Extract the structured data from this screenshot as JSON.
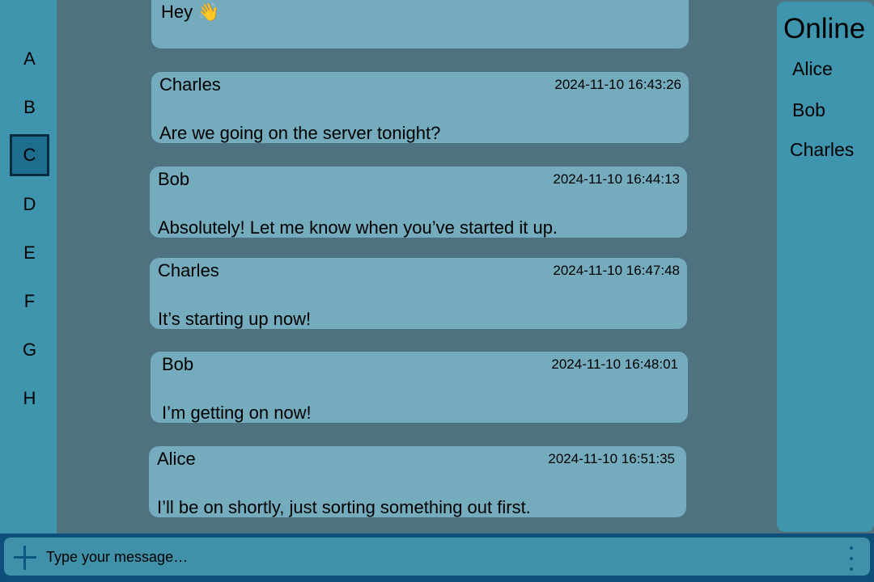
{
  "servers": [
    "A",
    "B",
    "C",
    "D",
    "E",
    "F",
    "G",
    "H"
  ],
  "active_server": "C",
  "messages": [
    {
      "author": "",
      "time": "",
      "text": "Hey 👋"
    },
    {
      "author": "Charles",
      "time": "2024-11-10 16:43:26",
      "text": "Are we going on the server tonight?"
    },
    {
      "author": "Bob",
      "time": "2024-11-10 16:44:13",
      "text": "Absolutely! Let me know when you’ve started it up."
    },
    {
      "author": "Charles",
      "time": "2024-11-10 16:47:48",
      "text": "It’s starting up now!"
    },
    {
      "author": "Bob",
      "time": "2024-11-10 16:48:01",
      "text": "I’m getting on now!"
    },
    {
      "author": "Alice",
      "time": "2024-11-10 16:51:35",
      "text": "I’ll be on shortly, just sorting something out first."
    }
  ],
  "online": {
    "title": "Online",
    "users": [
      "Alice",
      "Bob",
      "Charles"
    ]
  },
  "composer": {
    "placeholder": "Type your message…",
    "value": "",
    "add_icon": "plus-icon",
    "menu_icon": "vertical-dots-icon"
  },
  "colors": {
    "background": "#4e727f",
    "panel": "#3f95ae",
    "bubble": "#74abbd",
    "active_server": "#1f6d8d",
    "composer_border": "#0d527c"
  }
}
